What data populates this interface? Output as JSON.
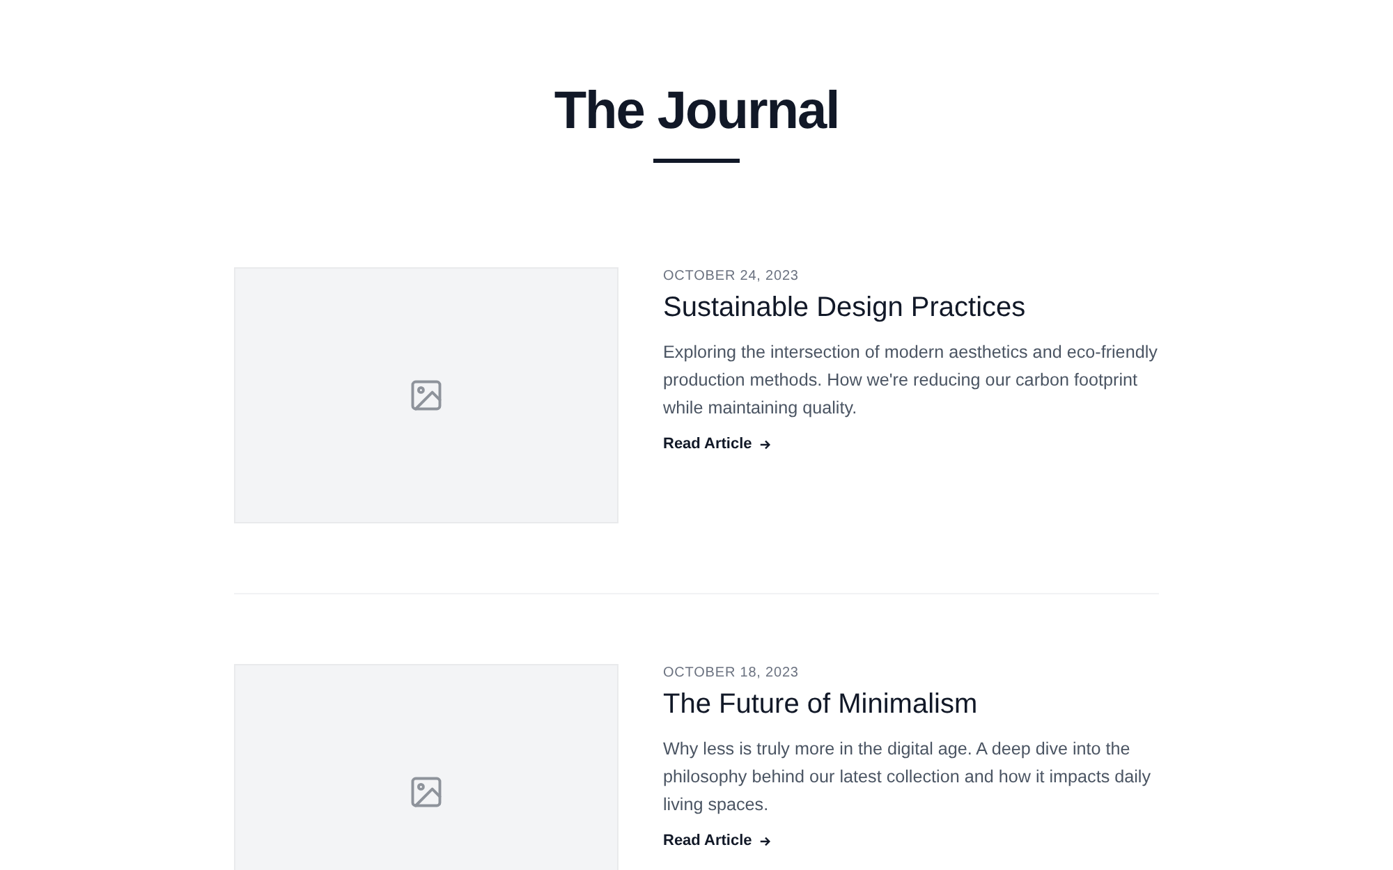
{
  "title": "The Journal",
  "articles": [
    {
      "date": "OCTOBER 24, 2023",
      "title": "Sustainable Design Practices",
      "excerpt": "Exploring the intersection of modern aesthetics and eco-friendly production methods. How we're reducing our carbon footprint while maintaining quality.",
      "link": "Read Article"
    },
    {
      "date": "OCTOBER 18, 2023",
      "title": "The Future of Minimalism",
      "excerpt": "Why less is truly more in the digital age. A deep dive into the philosophy behind our latest collection and how it impacts daily living spaces.",
      "link": "Read Article"
    }
  ]
}
